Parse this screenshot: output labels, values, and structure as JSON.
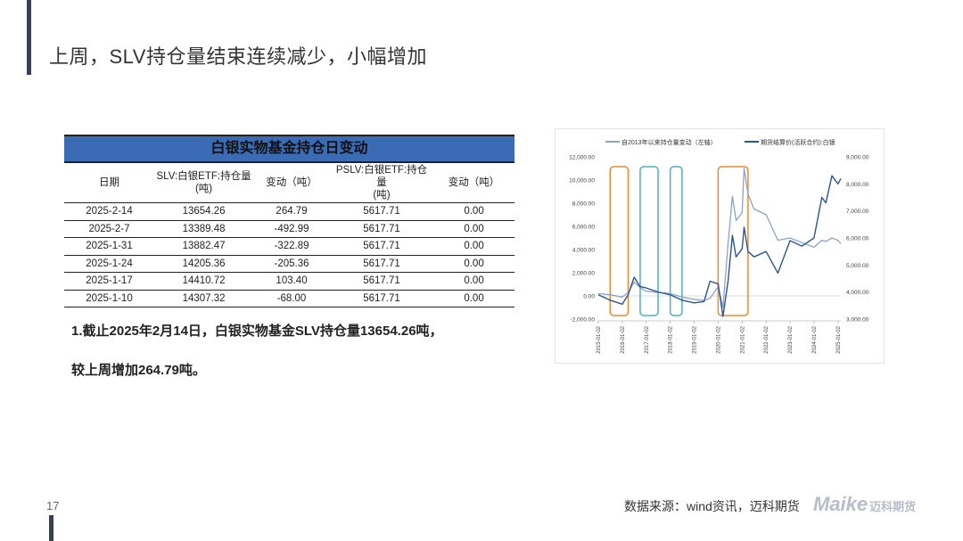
{
  "slide": {
    "title": "上周，SLV持仓量结束连续减少，小幅增加",
    "page_number": "17",
    "source": "数据来源：wind资讯，迈科期货",
    "logo_text": "Maike",
    "logo_cn": "迈科期货",
    "accent_color": "#3b3f56"
  },
  "table": {
    "title": "白银实物基金持仓日变动",
    "header_color": "#3b6bb4",
    "headers": [
      "日期",
      "SLV:白银ETF:持仓量\n(吨)",
      "变动（吨）",
      "PSLV:白银ETF:持仓量\n(吨)",
      "变动（吨）"
    ],
    "rows": [
      [
        "2025-2-14",
        "13654.26",
        "264.79",
        "5617.71",
        "0.00"
      ],
      [
        "2025-2-7",
        "13389.48",
        "-492.99",
        "5617.71",
        "0.00"
      ],
      [
        "2025-1-31",
        "13882.47",
        "-322.89",
        "5617.71",
        "0.00"
      ],
      [
        "2025-1-24",
        "14205.36",
        "-205.36",
        "5617.71",
        "0.00"
      ],
      [
        "2025-1-17",
        "14410.72",
        "103.40",
        "5617.71",
        "0.00"
      ],
      [
        "2025-1-10",
        "14307.32",
        "-68.00",
        "5617.71",
        "0.00"
      ]
    ]
  },
  "summary": {
    "line1": "1.截止2025年2月14日，白银实物基金SLV持仓量13654.26吨，",
    "line2": "较上周增加264.79吨。"
  },
  "chart_data": {
    "type": "line",
    "legend_position": "top",
    "grid": false,
    "x": [
      "2015-01-02",
      "2015-07-01",
      "2016-01-02",
      "2016-04-01",
      "2016-07-01",
      "2016-10-01",
      "2017-01-02",
      "2017-07-01",
      "2018-01-02",
      "2018-07-01",
      "2019-01-02",
      "2019-06-01",
      "2019-09-01",
      "2020-01-02",
      "2020-03-15",
      "2020-06-01",
      "2020-08-07",
      "2020-10-01",
      "2021-01-02",
      "2021-02-01",
      "2021-04-01",
      "2021-07-01",
      "2022-01-02",
      "2022-07-01",
      "2023-01-02",
      "2023-07-01",
      "2024-01-02",
      "2024-05-01",
      "2024-07-01",
      "2024-10-01",
      "2025-01-02",
      "2025-02-14"
    ],
    "x_ticks": [
      "2015-01-02",
      "2016-01-02",
      "2017-01-02",
      "2018-01-02",
      "2019-01-02",
      "2020-01-02",
      "2021-01-02",
      "2022-01-02",
      "2023-01-02",
      "2024-01-02",
      "2025-01-02"
    ],
    "series": [
      {
        "name": "自2013年以来持仓量变动（左轴）",
        "axis": "left",
        "color": "#8ea2c8",
        "values": [
          200,
          100,
          -100,
          300,
          1200,
          700,
          400,
          300,
          200,
          -100,
          -300,
          -400,
          -200,
          800,
          -1000,
          4500,
          8600,
          6500,
          7200,
          11000,
          8800,
          7500,
          7000,
          4800,
          5000,
          4600,
          4200,
          4800,
          4700,
          5000,
          4800,
          4500
        ]
      },
      {
        "name": "期货结算价(活跃合约):白银",
        "axis": "right",
        "color": "#2e5590",
        "values": [
          3900,
          3700,
          3550,
          3900,
          4550,
          4200,
          4150,
          4000,
          3900,
          3700,
          3600,
          3650,
          4400,
          4300,
          3100,
          4400,
          6100,
          5300,
          5600,
          6400,
          5500,
          5300,
          5500,
          4700,
          5900,
          5700,
          6000,
          7500,
          7300,
          8300,
          8000,
          8200
        ]
      }
    ],
    "y_left": {
      "lim": [
        -2000,
        12000
      ],
      "ticks": [
        "-2,000.00",
        "0.00",
        "2,000.00",
        "4,000.00",
        "6,000.00",
        "8,000.00",
        "10,000.00",
        "12,000.00"
      ]
    },
    "y_right": {
      "lim": [
        3000,
        9000
      ],
      "ticks": [
        "3,000.00",
        "4,000.00",
        "5,000.00",
        "6,000.00",
        "7,000.00",
        "8,000.00",
        "9,000.00"
      ]
    },
    "highlight_boxes": [
      {
        "color": "#ed8a2f",
        "x_start": "2015-07-01",
        "x_end": "2016-04-01"
      },
      {
        "color": "#4ab3c3",
        "x_start": "2016-10-01",
        "x_end": "2017-07-01"
      },
      {
        "color": "#4ab3c3",
        "x_start": "2018-01-02",
        "x_end": "2018-07-01"
      },
      {
        "color": "#ed8a2f",
        "x_start": "2020-01-02",
        "x_end": "2021-04-01"
      }
    ]
  }
}
